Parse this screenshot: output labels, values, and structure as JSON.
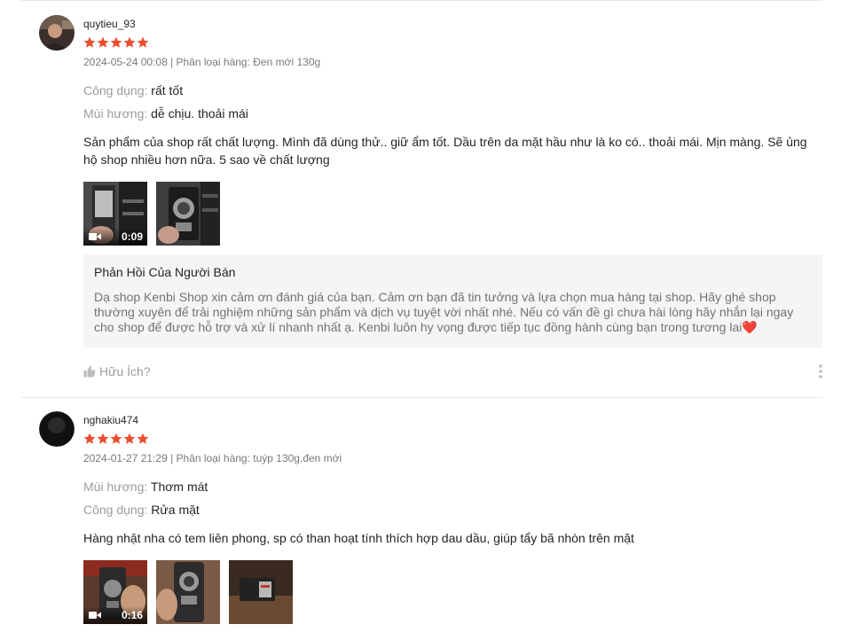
{
  "colors": {
    "star": "#ee4d2d",
    "seller_bg": "#f5f5f5",
    "heart": "#ee4d6b"
  },
  "reviews": [
    {
      "username": "quytieu_93",
      "rating": 5,
      "meta": "2024-05-24 00:08 | Phân loại hàng: Đen mới 130g",
      "attributes": [
        {
          "key": "Công dụng: ",
          "value": "rất tốt"
        },
        {
          "key": "Mùi hương: ",
          "value": "dễ chịu. thoải mái"
        }
      ],
      "comment": "Sản phẩm của shop rất chất lượng. Mình đã dùng thử.. giữ ẩm tốt. Dầu trên da mặt hầu như là ko có.. thoải mái. Mịn màng. Sẽ ủng hộ shop nhiều hơn nữa. 5 sao về chất lượng",
      "media": [
        {
          "type": "video",
          "duration": "0:09",
          "icon": "video-camera-icon"
        },
        {
          "type": "image"
        }
      ],
      "seller_reply": {
        "title": "Phản Hồi Của Người Bán",
        "body": "Dạ shop Kenbi Shop xin cảm ơn đánh giá của bạn. Cảm ơn bạn đã tin tưởng và lựa chọn mua hàng tại shop. Hãy ghé shop thường xuyên để trải nghiệm những sản phẩm và dịch vụ tuyệt vời nhất nhé. Nếu có vấn đề gì chưa hài lòng hãy nhắn lại ngay cho shop để được hỗ trợ và xử lí nhanh nhất ạ. Kenbi luôn hy vọng được tiếp tục đồng hành cùng bạn trong tương lai",
        "heart": "❤️"
      },
      "helpful_label": "Hữu Ích?"
    },
    {
      "username": "nghakiu474",
      "rating": 5,
      "meta": "2024-01-27 21:29 | Phân loại hàng: tuýp 130g,đen mới",
      "attributes": [
        {
          "key": "Mùi hương: ",
          "value": "Thơm mát"
        },
        {
          "key": "Công dụng: ",
          "value": "Rửa mặt"
        }
      ],
      "comment": "Hàng nhật nha có tem liên phong, sp có than hoạt tính thích hợp dau dầu, giúp tẩy bã nhòn trên mặt",
      "media": [
        {
          "type": "video",
          "duration": "0:16",
          "icon": "video-camera-icon"
        },
        {
          "type": "image"
        },
        {
          "type": "image"
        }
      ]
    }
  ]
}
